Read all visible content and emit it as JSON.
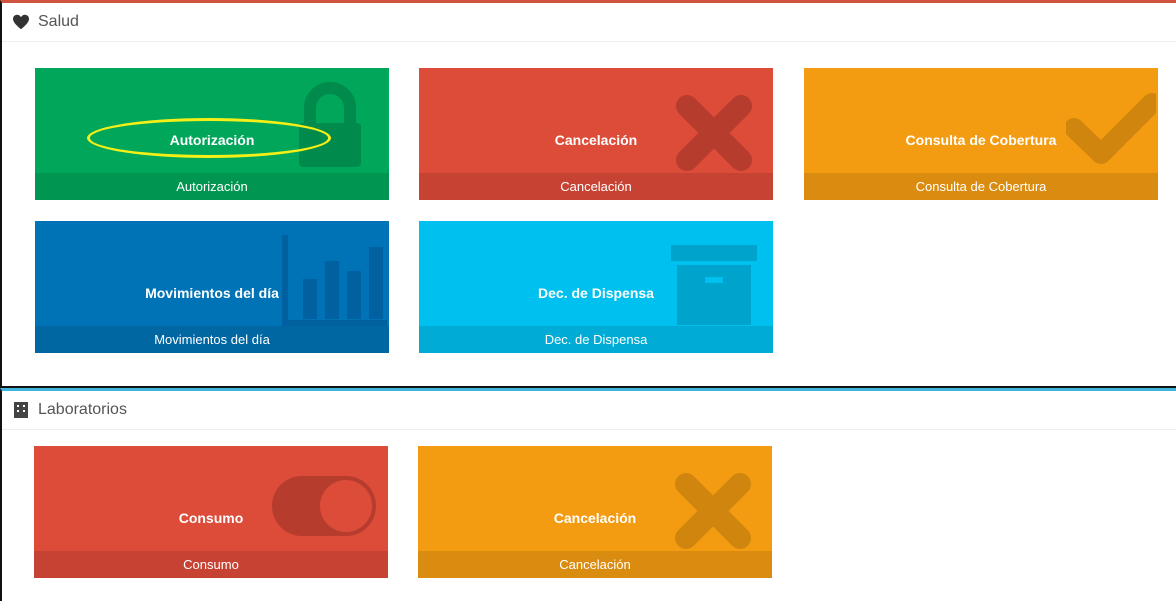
{
  "sections": [
    {
      "title": "Salud",
      "icon": "heart-icon",
      "tiles": [
        {
          "label": "Autorización",
          "footer": "Autorización",
          "color": "#00a65a",
          "icon": "lock-icon"
        },
        {
          "label": "Cancelación",
          "footer": "Cancelación",
          "color": "#dd4b39",
          "icon": "close-icon"
        },
        {
          "label": "Consulta de Cobertura",
          "footer": "Consulta de Cobertura",
          "color": "#f39c12",
          "icon": "check-icon"
        },
        {
          "label": "Movimientos del día",
          "footer": "Movimientos del día",
          "color": "#0073b7",
          "icon": "bar-chart-icon"
        },
        {
          "label": "Dec. de Dispensa",
          "footer": "Dec. de Dispensa",
          "color": "#00c0ef",
          "icon": "archive-icon"
        }
      ]
    },
    {
      "title": "Laboratorios",
      "icon": "building-icon",
      "tiles": [
        {
          "label": "Consumo",
          "footer": "Consumo",
          "color": "#dd4b39",
          "icon": "toggle-icon"
        },
        {
          "label": "Cancelación",
          "footer": "Cancelación",
          "color": "#f39c12",
          "icon": "close-icon"
        }
      ]
    }
  ],
  "annotation": {
    "highlight_color": "#f5ef18",
    "target": "Autorización"
  }
}
